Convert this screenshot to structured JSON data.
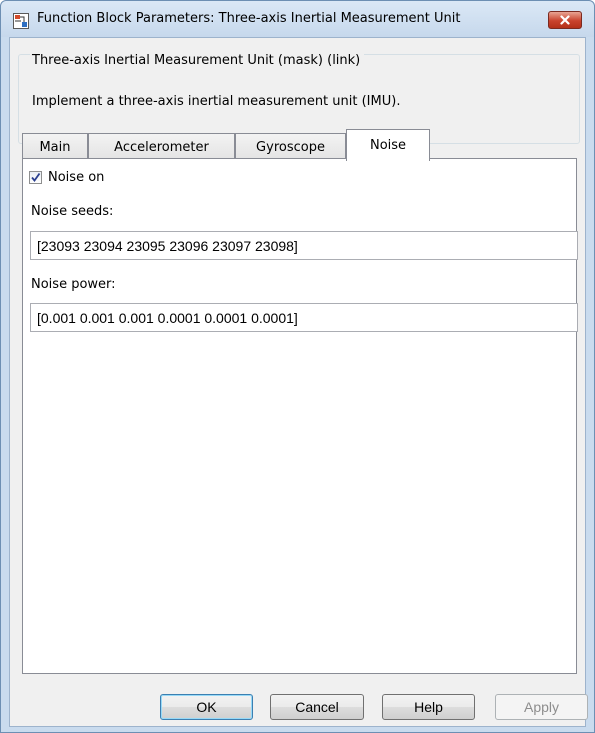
{
  "window": {
    "title": "Function Block Parameters: Three-axis Inertial Measurement Unit",
    "icon": "simulink-block-icon"
  },
  "mask": {
    "title": "Three-axis Inertial Measurement Unit (mask) (link)",
    "description": "Implement a three-axis inertial measurement unit (IMU)."
  },
  "tabs": [
    {
      "label": "Main"
    },
    {
      "label": "Accelerometer"
    },
    {
      "label": "Gyroscope"
    },
    {
      "label": "Noise"
    }
  ],
  "active_tab": "Noise",
  "noise": {
    "noise_on_label": "Noise on",
    "noise_on_checked": true,
    "seeds_label": "Noise seeds:",
    "seeds_value": "[23093 23094 23095 23096 23097 23098]",
    "power_label": "Noise power:",
    "power_value": "[0.001 0.001 0.001 0.0001 0.0001 0.0001]"
  },
  "buttons": {
    "ok": "OK",
    "cancel": "Cancel",
    "help": "Help",
    "apply": "Apply"
  },
  "colors": {
    "close_button": "#c9432d",
    "frame": "#c9dbee"
  }
}
